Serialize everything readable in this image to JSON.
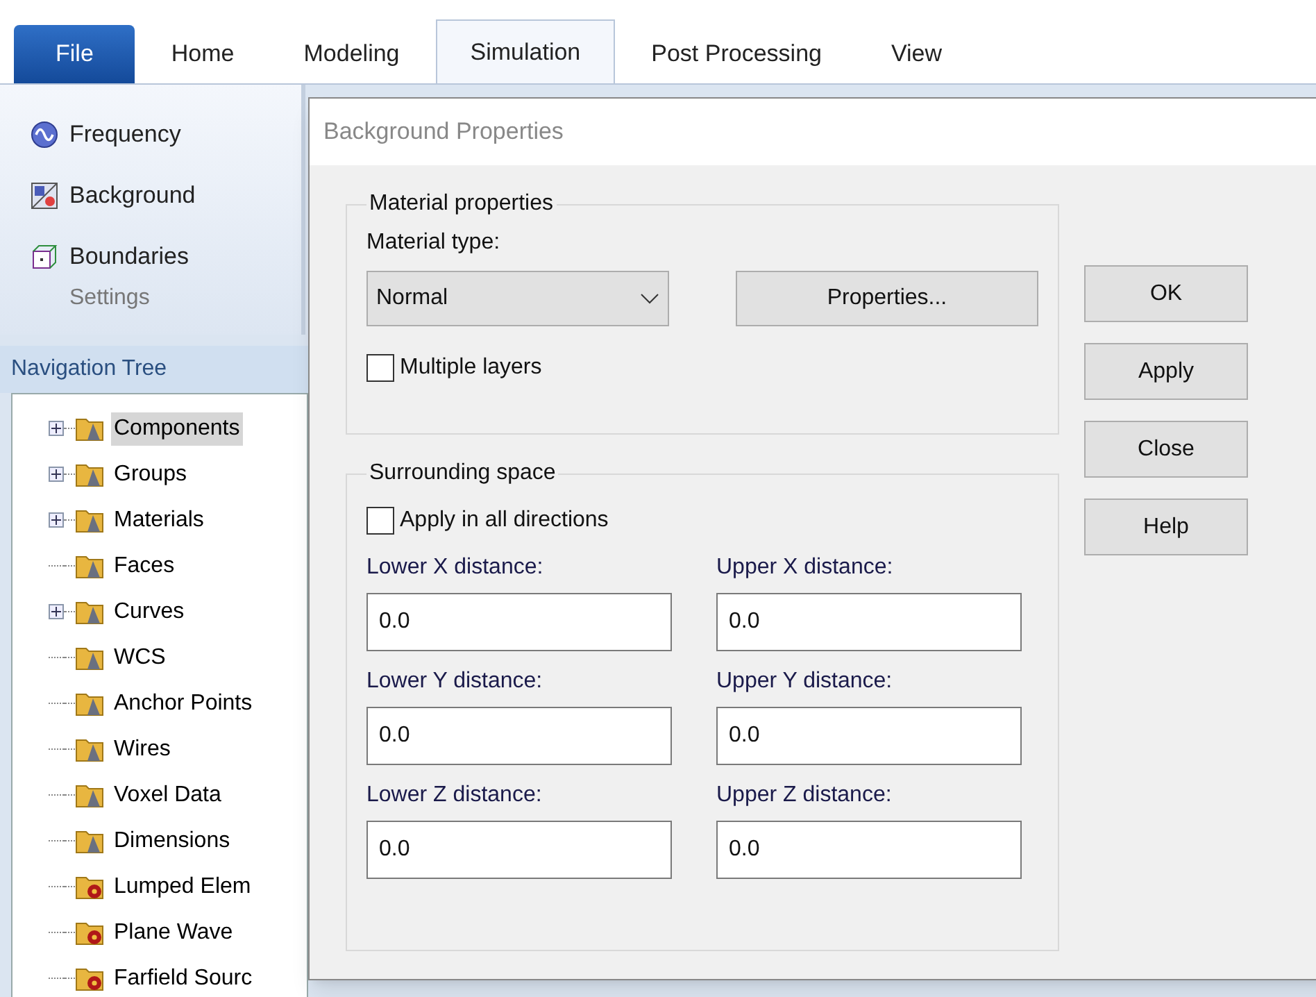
{
  "ribbon": {
    "tabs": [
      {
        "label": "File",
        "kind": "file",
        "selected": false
      },
      {
        "label": "Home",
        "kind": "tab",
        "selected": false
      },
      {
        "label": "Modeling",
        "kind": "tab",
        "selected": false
      },
      {
        "label": "Simulation",
        "kind": "tab",
        "selected": true
      },
      {
        "label": "Post Processing",
        "kind": "tab",
        "selected": false
      },
      {
        "label": "View",
        "kind": "tab",
        "selected": false
      }
    ],
    "group": {
      "items": [
        {
          "label": "Frequency",
          "kind": "frequency"
        },
        {
          "label": "Background",
          "kind": "background"
        },
        {
          "label": "Boundaries",
          "kind": "boundaries"
        }
      ],
      "caption": "Settings"
    }
  },
  "navigation_tree": {
    "title": "Navigation Tree",
    "items": [
      {
        "label": "Components",
        "kind": "folder",
        "expandable": true,
        "selected": true
      },
      {
        "label": "Groups",
        "kind": "folder",
        "expandable": true,
        "selected": false
      },
      {
        "label": "Materials",
        "kind": "folder",
        "expandable": true,
        "selected": false
      },
      {
        "label": "Faces",
        "kind": "folder",
        "expandable": false,
        "selected": false
      },
      {
        "label": "Curves",
        "kind": "folder",
        "expandable": true,
        "selected": false
      },
      {
        "label": "WCS",
        "kind": "folder",
        "expandable": false,
        "selected": false
      },
      {
        "label": "Anchor Points",
        "kind": "folder",
        "expandable": false,
        "selected": false
      },
      {
        "label": "Wires",
        "kind": "folder",
        "expandable": false,
        "selected": false
      },
      {
        "label": "Voxel Data",
        "kind": "folder",
        "expandable": false,
        "selected": false
      },
      {
        "label": "Dimensions",
        "kind": "folder",
        "expandable": false,
        "selected": false
      },
      {
        "label": "Lumped Elem",
        "kind": "source",
        "expandable": false,
        "selected": false
      },
      {
        "label": "Plane Wave",
        "kind": "source",
        "expandable": false,
        "selected": false
      },
      {
        "label": "Farfield Sourc",
        "kind": "source",
        "expandable": false,
        "selected": false
      }
    ]
  },
  "dialog": {
    "title": "Background Properties",
    "material": {
      "title": "Material properties",
      "type_label": "Material type:",
      "type_value": "Normal",
      "properties_button": "Properties...",
      "multiple_layers": {
        "label": "Multiple layers",
        "checked": false
      }
    },
    "surrounding": {
      "title": "Surrounding space",
      "all_directions": {
        "label": "Apply in all directions",
        "checked": false
      },
      "fields": [
        {
          "label": "Lower X distance:",
          "value": "0.0"
        },
        {
          "label": "Upper X distance:",
          "value": "0.0"
        },
        {
          "label": "Lower Y distance:",
          "value": "0.0"
        },
        {
          "label": "Upper Y distance:",
          "value": "0.0"
        },
        {
          "label": "Lower Z distance:",
          "value": "0.0"
        },
        {
          "label": "Upper Z distance:",
          "value": "0.0"
        }
      ]
    },
    "buttons": [
      "OK",
      "Apply",
      "Close",
      "Help"
    ]
  }
}
